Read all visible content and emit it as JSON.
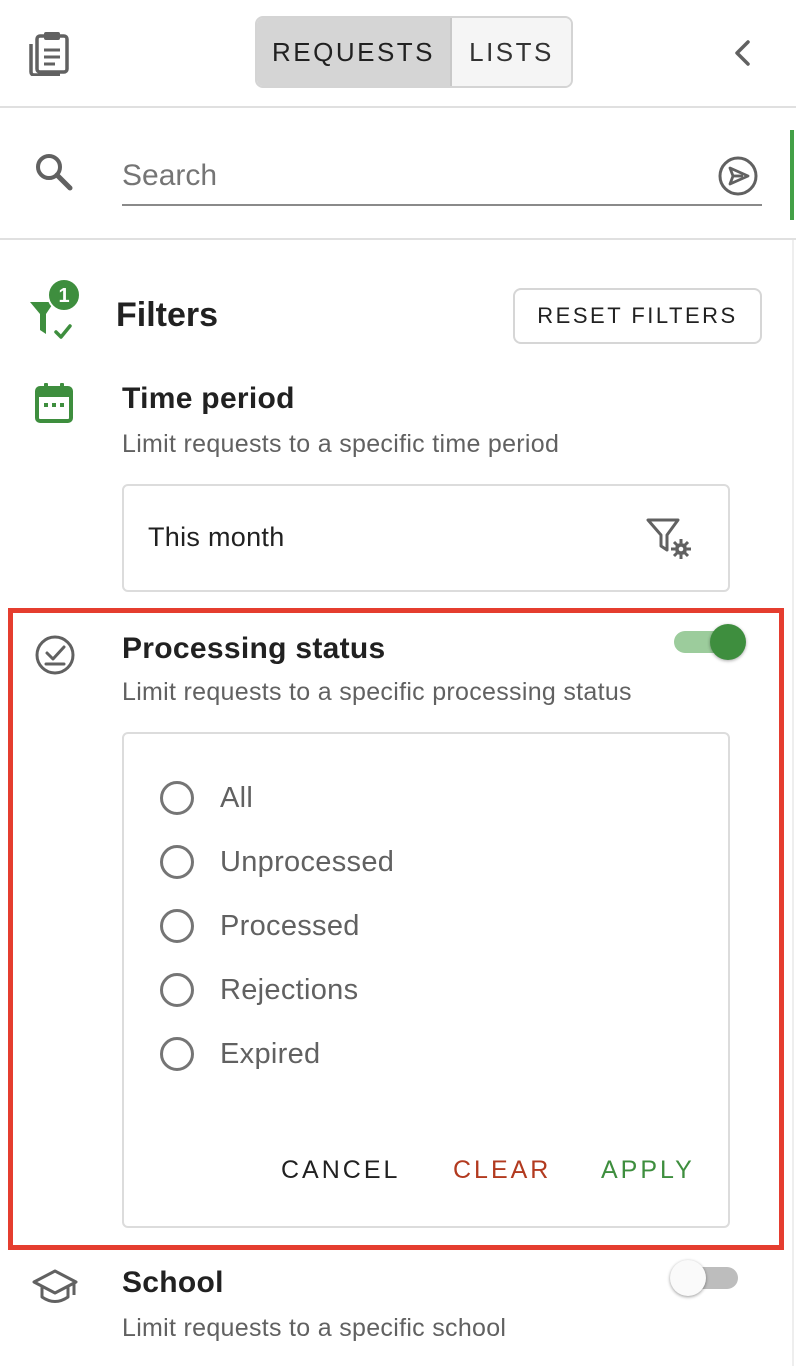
{
  "tabs": {
    "requests_label": "REQUESTS",
    "lists_label": "LISTS",
    "active": "REQUESTS"
  },
  "search": {
    "placeholder": "Search",
    "value": ""
  },
  "filters": {
    "title": "Filters",
    "active_count": "1",
    "reset_label": "RESET FILTERS"
  },
  "time_period": {
    "title": "Time period",
    "subtitle": "Limit requests to a specific time period",
    "value": "This month"
  },
  "processing_status": {
    "title": "Processing status",
    "subtitle": "Limit requests to a specific processing status",
    "enabled": true,
    "options": [
      "All",
      "Unprocessed",
      "Processed",
      "Rejections",
      "Expired"
    ],
    "cancel_label": "CANCEL",
    "clear_label": "CLEAR",
    "apply_label": "APPLY"
  },
  "school": {
    "title": "School",
    "subtitle": "Limit requests to a specific school",
    "enabled": false
  },
  "colors": {
    "accent_green": "#3e8e3e",
    "clear_red": "#b23a1f",
    "highlight_red": "#e53d2f",
    "icon_grey": "#616161"
  },
  "icons": {
    "header": "clipboard-icon",
    "collapse": "chevron-left-icon",
    "search": "search-icon",
    "send": "send-icon",
    "filters": "filter-check-icon",
    "time_period": "calendar-icon",
    "time_period_action": "filter-settings-icon",
    "processing_status": "check-circle-icon",
    "school": "school-icon"
  }
}
